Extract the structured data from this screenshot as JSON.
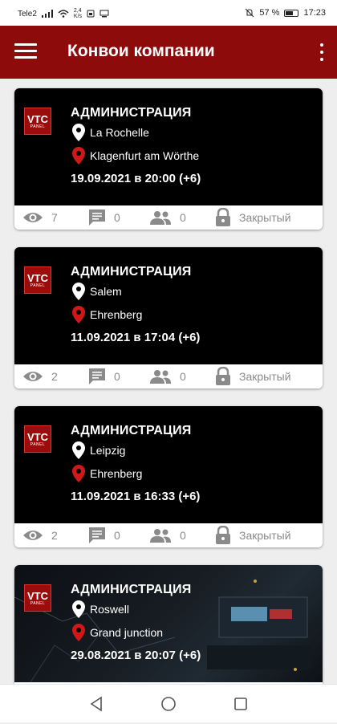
{
  "statusbar": {
    "carrier": "Tele2",
    "speed_top": "2,4",
    "speed_bottom": "K/s",
    "battery_percent": "57 %",
    "time": "17:23"
  },
  "appbar": {
    "title": "Конвои компании"
  },
  "convoys": [
    {
      "organizer": "АДМИНИСТРАЦИЯ",
      "from": "La Rochelle",
      "to": "Klagenfurt am Wörthe",
      "datetime": "19.09.2021 в 20:00 (+6)",
      "views": "7",
      "comments": "0",
      "participants": "0",
      "access": "Закрытый",
      "has_image": false
    },
    {
      "organizer": "АДМИНИСТРАЦИЯ",
      "from": "Salem",
      "to": "Ehrenberg",
      "datetime": "11.09.2021 в 17:04 (+6)",
      "views": "2",
      "comments": "0",
      "participants": "0",
      "access": "Закрытый",
      "has_image": false
    },
    {
      "organizer": "АДМИНИСТРАЦИЯ",
      "from": "Leipzig",
      "to": "Ehrenberg",
      "datetime": "11.09.2021 в 16:33 (+6)",
      "views": "2",
      "comments": "0",
      "participants": "0",
      "access": "Закрытый",
      "has_image": false
    },
    {
      "organizer": "АДМИНИСТРАЦИЯ",
      "from": "Roswell",
      "to": "Grand junction",
      "datetime": "29.08.2021 в 20:07 (+6)",
      "views": "",
      "comments": "",
      "participants": "",
      "access": "",
      "has_image": true
    }
  ],
  "logo": {
    "line1": "VTC",
    "line2": "PANEL"
  },
  "colors": {
    "appbar": "#8e0b0b",
    "pin_from": "#ffffff",
    "pin_to": "#d01818",
    "stat_gray": "#8a8a8a"
  },
  "icons": [
    "menu-icon",
    "more-vert-icon",
    "eye-icon",
    "comment-icon",
    "people-icon",
    "lock-icon",
    "location-pin-icon",
    "nav-back-icon",
    "nav-home-icon",
    "nav-recents-icon"
  ]
}
